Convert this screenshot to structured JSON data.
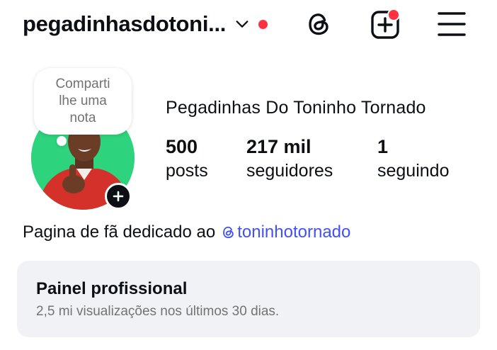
{
  "header": {
    "username": "pegadinhasdotoni...",
    "icons": {
      "account_switch": "chevron-down-icon",
      "threads": "threads-icon",
      "create": "create-icon",
      "menu": "menu-icon"
    }
  },
  "profile": {
    "note_placeholder": "Comparti lhe uma nota",
    "display_name": "Pegadinhas Do Toninho Tornado",
    "stats": [
      {
        "value": "500",
        "label": "posts"
      },
      {
        "value": "217 mil",
        "label": "seguidores"
      },
      {
        "value": "1",
        "label": "seguindo"
      }
    ],
    "bio_text": "Pagina de fã dedicado ao",
    "bio_link": "toninhotornado"
  },
  "pro_panel": {
    "title": "Painel profissional",
    "subtitle": "2,5 mi visualizações nos últimos 30 dias."
  },
  "colors": {
    "notification": "#ff3040",
    "link": "#4150f7",
    "panel_bg": "#f0f2f5",
    "avatar_bg": "#2ed37e"
  }
}
